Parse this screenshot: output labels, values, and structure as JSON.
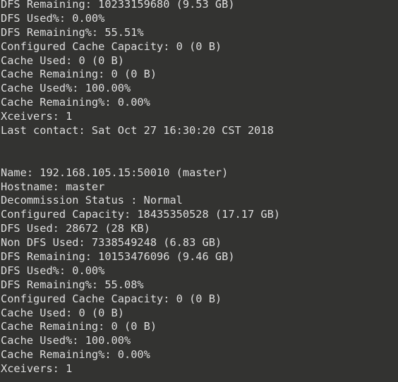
{
  "terminal": {
    "background_color": "#333331",
    "foreground_color": "#dedede",
    "lines": [
      "DFS Remaining: 10233159680 (9.53 GB)",
      "DFS Used%: 0.00%",
      "DFS Remaining%: 55.51%",
      "Configured Cache Capacity: 0 (0 B)",
      "Cache Used: 0 (0 B)",
      "Cache Remaining: 0 (0 B)",
      "Cache Used%: 100.00%",
      "Cache Remaining%: 0.00%",
      "Xceivers: 1",
      "Last contact: Sat Oct 27 16:30:20 CST 2018",
      "",
      "",
      "Name: 192.168.105.15:50010 (master)",
      "Hostname: master",
      "Decommission Status : Normal",
      "Configured Capacity: 18435350528 (17.17 GB)",
      "DFS Used: 28672 (28 KB)",
      "Non DFS Used: 7338549248 (6.83 GB)",
      "DFS Remaining: 10153476096 (9.46 GB)",
      "DFS Used%: 0.00%",
      "DFS Remaining%: 55.08%",
      "Configured Cache Capacity: 0 (0 B)",
      "Cache Used: 0 (0 B)",
      "Cache Remaining: 0 (0 B)",
      "Cache Used%: 100.00%",
      "Cache Remaining%: 0.00%",
      "Xceivers: 1"
    ]
  }
}
